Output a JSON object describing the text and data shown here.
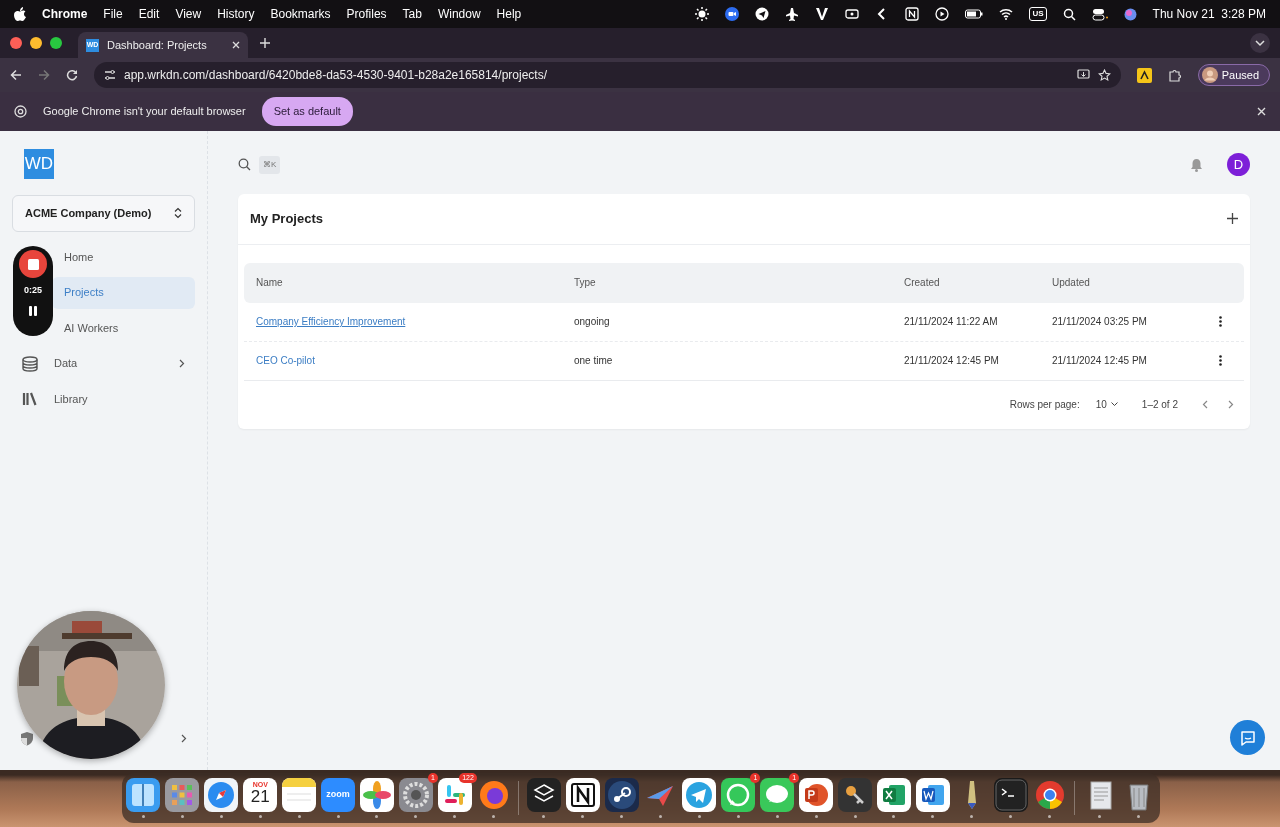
{
  "menu_bar": {
    "app": "Chrome",
    "menus": [
      "File",
      "Edit",
      "View",
      "History",
      "Bookmarks",
      "Profiles",
      "Tab",
      "Window",
      "Help"
    ],
    "input_source": "US",
    "clock": "Thu Nov 21  3:28 PM"
  },
  "browser": {
    "tab": {
      "favicon": "WD",
      "title": "Dashboard: Projects"
    },
    "url": "app.wrkdn.com/dashboard/6420bde8-da53-4530-9401-b28a2e165814/projects/",
    "profile": "Paused",
    "infobar": {
      "message": "Google Chrome isn't your default browser",
      "button": "Set as default"
    }
  },
  "sidebar": {
    "logo": "WD",
    "workspace": "ACME Company (Demo)",
    "items": [
      {
        "label": "Home",
        "kind": "covered",
        "selected": false,
        "expandable": false
      },
      {
        "label": "Projects",
        "kind": "covered",
        "selected": true,
        "expandable": false
      },
      {
        "label": "AI Workers",
        "kind": "covered",
        "selected": false,
        "expandable": false
      },
      {
        "label": "Data",
        "kind": "data",
        "selected": false,
        "expandable": true
      },
      {
        "label": "Library",
        "kind": "library",
        "selected": false,
        "expandable": false
      }
    ]
  },
  "topbar": {
    "shortcut": "⌘K",
    "avatar": "D"
  },
  "projects": {
    "title": "My Projects",
    "columns": [
      "Name",
      "Type",
      "Created",
      "Updated"
    ],
    "rows": [
      {
        "name": "Company Efficiency Improvement",
        "hovered": true,
        "type": "ongoing",
        "created": "21/11/2024 11:22 AM",
        "updated": "21/11/2024 03:25 PM"
      },
      {
        "name": "CEO Co-pilot",
        "hovered": false,
        "type": "one time",
        "created": "21/11/2024 12:45 PM",
        "updated": "21/11/2024 12:45 PM"
      }
    ],
    "rows_per_page_label": "Rows per page:",
    "rows_per_page": "10",
    "range": "1–2 of 2"
  },
  "recorder": {
    "time": "0:25"
  },
  "dock": [
    {
      "kind": "finder"
    },
    {
      "kind": "launchpad"
    },
    {
      "kind": "safari"
    },
    {
      "kind": "calendar",
      "month": "NOV",
      "day": "21"
    },
    {
      "kind": "notes"
    },
    {
      "kind": "zoom",
      "text": "zoom"
    },
    {
      "kind": "photos"
    },
    {
      "kind": "settings",
      "badge": "1"
    },
    {
      "kind": "slack",
      "badge": "122"
    },
    {
      "kind": "firefox"
    },
    {
      "kind": "separator"
    },
    {
      "kind": "layers"
    },
    {
      "kind": "notion"
    },
    {
      "kind": "steam"
    },
    {
      "kind": "plane"
    },
    {
      "kind": "telegram"
    },
    {
      "kind": "whatsapp",
      "badge": "1"
    },
    {
      "kind": "messages",
      "badge": "1"
    },
    {
      "kind": "powerpoint"
    },
    {
      "kind": "keychain"
    },
    {
      "kind": "excel"
    },
    {
      "kind": "word"
    },
    {
      "kind": "pen"
    },
    {
      "kind": "terminal"
    },
    {
      "kind": "chrome"
    },
    {
      "kind": "separator"
    },
    {
      "kind": "document"
    },
    {
      "kind": "trash"
    }
  ]
}
